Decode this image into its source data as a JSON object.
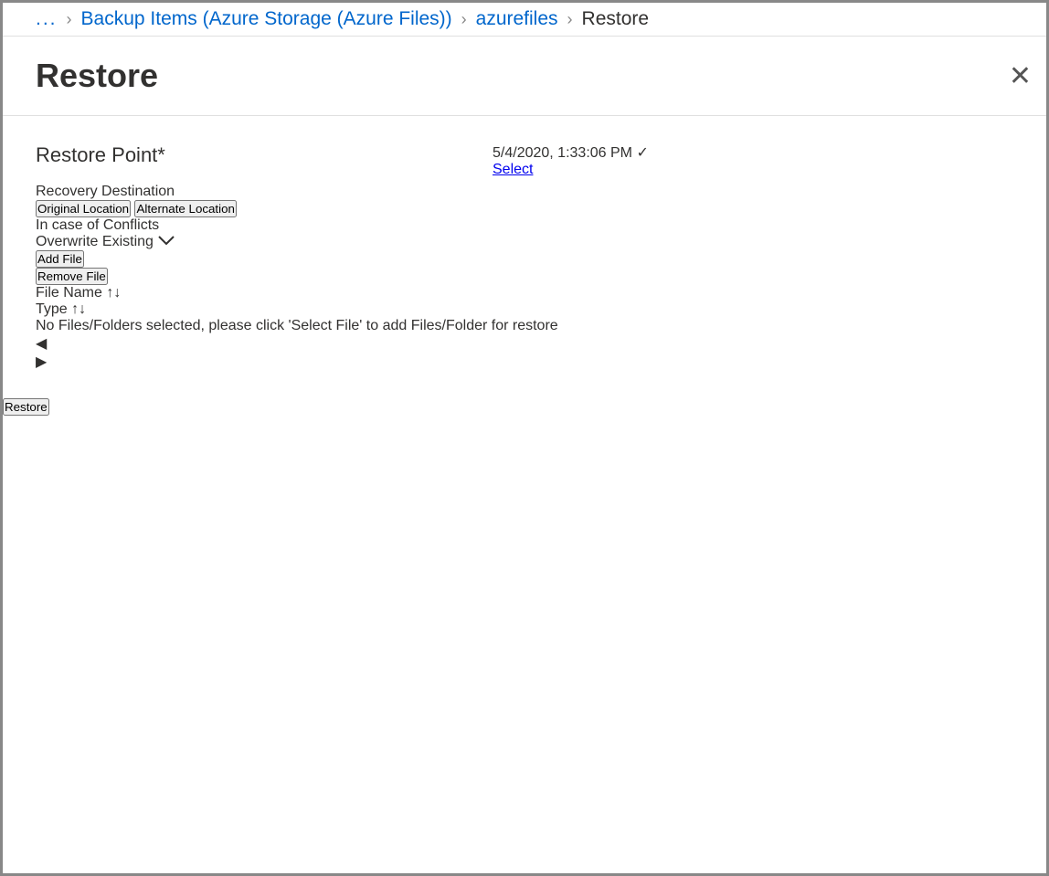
{
  "breadcrumb": {
    "ellipsis": "...",
    "items": [
      {
        "label": "Backup Items (Azure Storage (Azure Files))",
        "link": true
      },
      {
        "label": "azurefiles",
        "link": true
      },
      {
        "label": "Restore",
        "link": false
      }
    ]
  },
  "page": {
    "title": "Restore"
  },
  "restorePoint": {
    "label": "Restore Point",
    "value": "5/4/2020, 1:33:06 PM",
    "selectLink": "Select"
  },
  "recoveryDestination": {
    "heading": "Recovery Destination",
    "options": {
      "original": "Original Location",
      "alternate": "Alternate Location"
    }
  },
  "conflicts": {
    "label": "In case of Conflicts",
    "selected": "Overwrite Existing"
  },
  "fileActions": {
    "add": "Add File",
    "remove": "Remove File"
  },
  "table": {
    "columns": {
      "filename": "File Name",
      "type": "Type"
    },
    "emptyMessage": "No Files/Folders selected, please click 'Select File' to add Files/Folder for restore"
  },
  "footer": {
    "restore": "Restore"
  }
}
